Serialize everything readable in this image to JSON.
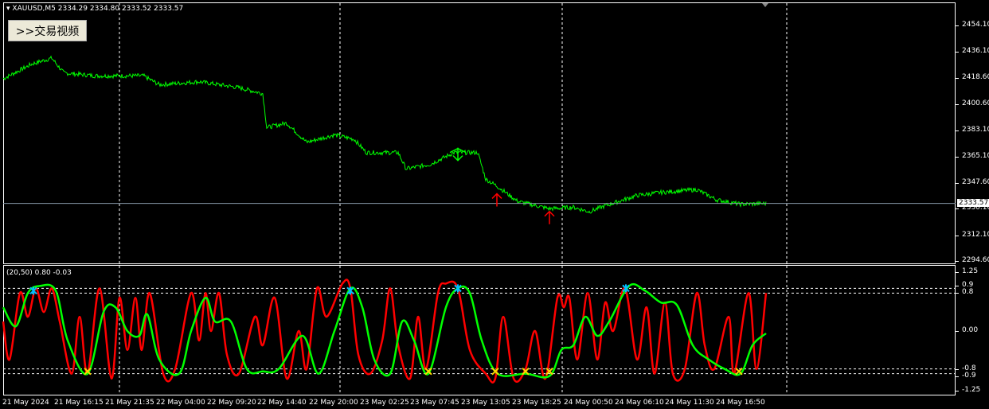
{
  "header": {
    "symbol": "XAUUSD,M5",
    "ohlc": "2334.29 2334.80 2333.52 2333.57"
  },
  "button": {
    "label": ">>交易视频"
  },
  "osc_header": "(20,50) 0.80 -0.03",
  "current_price": "2333.57",
  "colors": {
    "price": "#00ff00",
    "osc_fast": "#ff0000",
    "osc_slow": "#00ff00",
    "grid": "#ffffff",
    "arrow": "#ff0000",
    "marker_cross": "#ffd700",
    "marker_star": "#00bfff"
  },
  "chart_data": [
    {
      "type": "line",
      "title": "XAUUSD,M5",
      "x_unit": "bars (5 min)",
      "ylim": [
        2294.6,
        2463
      ],
      "yticks": [
        "2454.10",
        "2436.10",
        "2418.60",
        "2400.60",
        "2383.10",
        "2365.10",
        "2347.60",
        "2330.10",
        "2312.10",
        "2294.60"
      ],
      "xticks": [
        "21 May 2024",
        "21 May 16:15",
        "21 May 21:35",
        "22 May 04:00",
        "22 May 09:20",
        "22 May 14:40",
        "22 May 20:00",
        "23 May 02:25",
        "23 May 07:45",
        "23 May 13:05",
        "23 May 18:25",
        "24 May 00:50",
        "24 May 06:10",
        "24 May 11:30",
        "24 May 16:50"
      ],
      "series": [
        {
          "name": "Close",
          "points": [
            [
              0,
              2418
            ],
            [
              36,
              2428
            ],
            [
              61,
              2432
            ],
            [
              76,
              2422
            ],
            [
              116,
              2420
            ],
            [
              176,
              2420
            ],
            [
              196,
              2414
            ],
            [
              246,
              2416
            ],
            [
              296,
              2412
            ],
            [
              326,
              2408
            ],
            [
              331,
              2385
            ],
            [
              356,
              2388
            ],
            [
              381,
              2375
            ],
            [
              416,
              2380
            ],
            [
              441,
              2377
            ],
            [
              456,
              2368
            ],
            [
              496,
              2368
            ],
            [
              506,
              2357
            ],
            [
              536,
              2360
            ],
            [
              566,
              2368
            ],
            [
              596,
              2368
            ],
            [
              606,
              2350
            ],
            [
              621,
              2345
            ],
            [
              646,
              2335
            ],
            [
              686,
              2330
            ],
            [
              716,
              2331
            ],
            [
              736,
              2328
            ],
            [
              756,
              2332
            ],
            [
              796,
              2339
            ],
            [
              826,
              2341
            ],
            [
              871,
              2343
            ],
            [
              896,
              2336
            ],
            [
              926,
              2333
            ],
            [
              958,
              2333.57
            ]
          ]
        }
      ],
      "signals": [
        {
          "type": "buy-arrow",
          "bar": 620,
          "price": 2338
        },
        {
          "type": "buy-arrow",
          "bar": 686,
          "price": 2326
        },
        {
          "type": "sell-marker",
          "bar": 571,
          "price": 2367
        }
      ]
    },
    {
      "type": "line",
      "title": "(20,50) 0.80 -0.03",
      "ylim": [
        -1.25,
        1.25
      ],
      "yticks": [
        "1.25",
        "0.9",
        "0.8",
        "0.00",
        "-0.8",
        "-0.9",
        "-1.25"
      ],
      "levels": [
        0.9,
        0.8,
        -0.8,
        -0.9
      ],
      "series": [
        {
          "name": "fast",
          "points": [
            [
              0,
              0.2
            ],
            [
              8,
              -0.6
            ],
            [
              21,
              0.8
            ],
            [
              31,
              0.3
            ],
            [
              41,
              0.9
            ],
            [
              51,
              0.4
            ],
            [
              61,
              0.9
            ],
            [
              71,
              0.2
            ],
            [
              86,
              -0.9
            ],
            [
              96,
              0.3
            ],
            [
              106,
              -0.9
            ],
            [
              121,
              0.9
            ],
            [
              136,
              -1.0
            ],
            [
              146,
              0.7
            ],
            [
              156,
              -0.4
            ],
            [
              166,
              0.7
            ],
            [
              174,
              -0.4
            ],
            [
              184,
              0.8
            ],
            [
              201,
              -0.9
            ],
            [
              216,
              -0.8
            ],
            [
              236,
              0.8
            ],
            [
              246,
              -0.2
            ],
            [
              254,
              0.8
            ],
            [
              261,
              0.0
            ],
            [
              271,
              0.8
            ],
            [
              281,
              -0.5
            ],
            [
              296,
              -0.9
            ],
            [
              316,
              0.3
            ],
            [
              326,
              -0.3
            ],
            [
              341,
              0.7
            ],
            [
              356,
              -1.0
            ],
            [
              371,
              0.0
            ],
            [
              381,
              -0.8
            ],
            [
              394,
              0.9
            ],
            [
              406,
              0.3
            ],
            [
              426,
              1.0
            ],
            [
              436,
              0.9
            ],
            [
              446,
              -0.5
            ],
            [
              461,
              -0.9
            ],
            [
              476,
              -0.2
            ],
            [
              486,
              0.9
            ],
            [
              496,
              -0.3
            ],
            [
              511,
              -1.0
            ],
            [
              521,
              0.3
            ],
            [
              531,
              -0.8
            ],
            [
              546,
              0.8
            ],
            [
              556,
              1.0
            ],
            [
              571,
              0.9
            ],
            [
              586,
              -0.4
            ],
            [
              606,
              -0.9
            ],
            [
              618,
              -1.0
            ],
            [
              628,
              0.3
            ],
            [
              641,
              -1.0
            ],
            [
              656,
              -0.8
            ],
            [
              668,
              0.0
            ],
            [
              681,
              -1.0
            ],
            [
              696,
              0.7
            ],
            [
              704,
              0.5
            ],
            [
              711,
              0.7
            ],
            [
              721,
              -0.6
            ],
            [
              734,
              0.8
            ],
            [
              746,
              -0.6
            ],
            [
              756,
              0.6
            ],
            [
              766,
              0.0
            ],
            [
              781,
              0.9
            ],
            [
              796,
              -0.6
            ],
            [
              808,
              0.5
            ],
            [
              818,
              -0.9
            ],
            [
              831,
              0.6
            ],
            [
              841,
              -0.9
            ],
            [
              856,
              -0.8
            ],
            [
              871,
              0.8
            ],
            [
              881,
              -0.3
            ],
            [
              893,
              -0.8
            ],
            [
              911,
              0.3
            ],
            [
              918,
              -0.9
            ],
            [
              936,
              0.8
            ],
            [
              946,
              -0.8
            ],
            [
              958,
              0.8
            ]
          ]
        },
        {
          "name": "slow",
          "points": [
            [
              0,
              0.5
            ],
            [
              16,
              0.1
            ],
            [
              31,
              0.8
            ],
            [
              46,
              0.95
            ],
            [
              66,
              0.85
            ],
            [
              81,
              -0.2
            ],
            [
              106,
              -0.9
            ],
            [
              126,
              0.4
            ],
            [
              141,
              0.5
            ],
            [
              156,
              0.0
            ],
            [
              171,
              -0.1
            ],
            [
              181,
              0.35
            ],
            [
              196,
              -0.6
            ],
            [
              221,
              -0.9
            ],
            [
              236,
              0.0
            ],
            [
              254,
              0.7
            ],
            [
              266,
              0.2
            ],
            [
              286,
              0.2
            ],
            [
              306,
              -0.8
            ],
            [
              326,
              -0.85
            ],
            [
              346,
              -0.8
            ],
            [
              376,
              -0.1
            ],
            [
              396,
              -0.9
            ],
            [
              416,
              0.0
            ],
            [
              436,
              0.9
            ],
            [
              451,
              0.5
            ],
            [
              466,
              -0.6
            ],
            [
              486,
              -0.9
            ],
            [
              501,
              0.2
            ],
            [
              516,
              -0.2
            ],
            [
              534,
              -0.9
            ],
            [
              556,
              0.5
            ],
            [
              571,
              0.9
            ],
            [
              586,
              0.8
            ],
            [
              601,
              -0.2
            ],
            [
              621,
              -0.9
            ],
            [
              656,
              -0.9
            ],
            [
              686,
              -0.95
            ],
            [
              701,
              -0.4
            ],
            [
              716,
              -0.3
            ],
            [
              731,
              0.3
            ],
            [
              746,
              -0.1
            ],
            [
              761,
              0.2
            ],
            [
              786,
              0.95
            ],
            [
              806,
              0.85
            ],
            [
              826,
              0.6
            ],
            [
              846,
              0.55
            ],
            [
              866,
              -0.3
            ],
            [
              886,
              -0.6
            ],
            [
              906,
              -0.8
            ],
            [
              926,
              -0.9
            ],
            [
              941,
              -0.3
            ],
            [
              958,
              -0.05
            ]
          ]
        }
      ],
      "markers": [
        {
          "type": "star",
          "bar": 38,
          "value": 0.85
        },
        {
          "type": "star",
          "bar": 436,
          "value": 0.85
        },
        {
          "type": "star",
          "bar": 571,
          "value": 0.9
        },
        {
          "type": "star",
          "bar": 782,
          "value": 0.9
        },
        {
          "type": "cross",
          "bar": 106,
          "value": -0.85
        },
        {
          "type": "cross",
          "bar": 534,
          "value": -0.85
        },
        {
          "type": "cross",
          "bar": 618,
          "value": -0.85
        },
        {
          "type": "cross",
          "bar": 656,
          "value": -0.85
        },
        {
          "type": "cross",
          "bar": 686,
          "value": -0.85
        },
        {
          "type": "cross",
          "bar": 924,
          "value": -0.85
        }
      ]
    }
  ]
}
